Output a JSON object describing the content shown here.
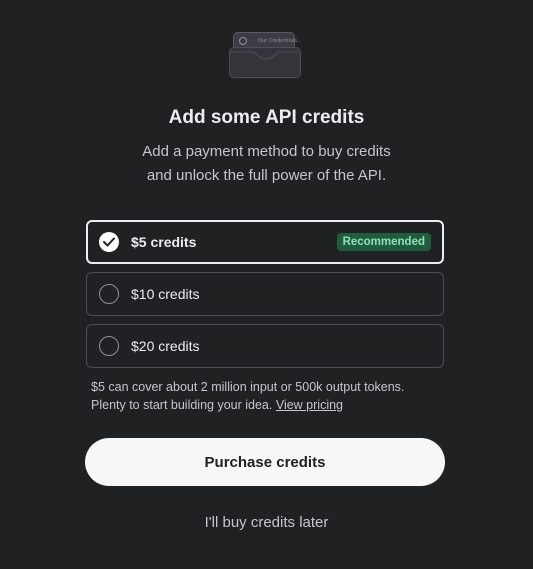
{
  "illustration": {
    "icon": "wallet-icon",
    "card_text": "Our Credentials..."
  },
  "header": {
    "title": "Add some API credits",
    "subtitle_line1": "Add a payment method to buy credits",
    "subtitle_line2": "and unlock the full power of the API."
  },
  "options": [
    {
      "label": "$5 credits",
      "selected": true,
      "badge": "Recommended"
    },
    {
      "label": "$10 credits",
      "selected": false
    },
    {
      "label": "$20 credits",
      "selected": false
    }
  ],
  "note": {
    "line1": "$5 can cover about 2 million input or 500k output tokens.",
    "line2_prefix": "Plenty to start building your idea.",
    "link": "View pricing"
  },
  "actions": {
    "purchase_label": "Purchase credits",
    "later_label": "I'll buy credits later"
  },
  "colors": {
    "background": "#202123",
    "badge_bg": "#1d5c3f",
    "badge_text": "#8fe0b4",
    "button_bg": "#f7f7f8"
  }
}
